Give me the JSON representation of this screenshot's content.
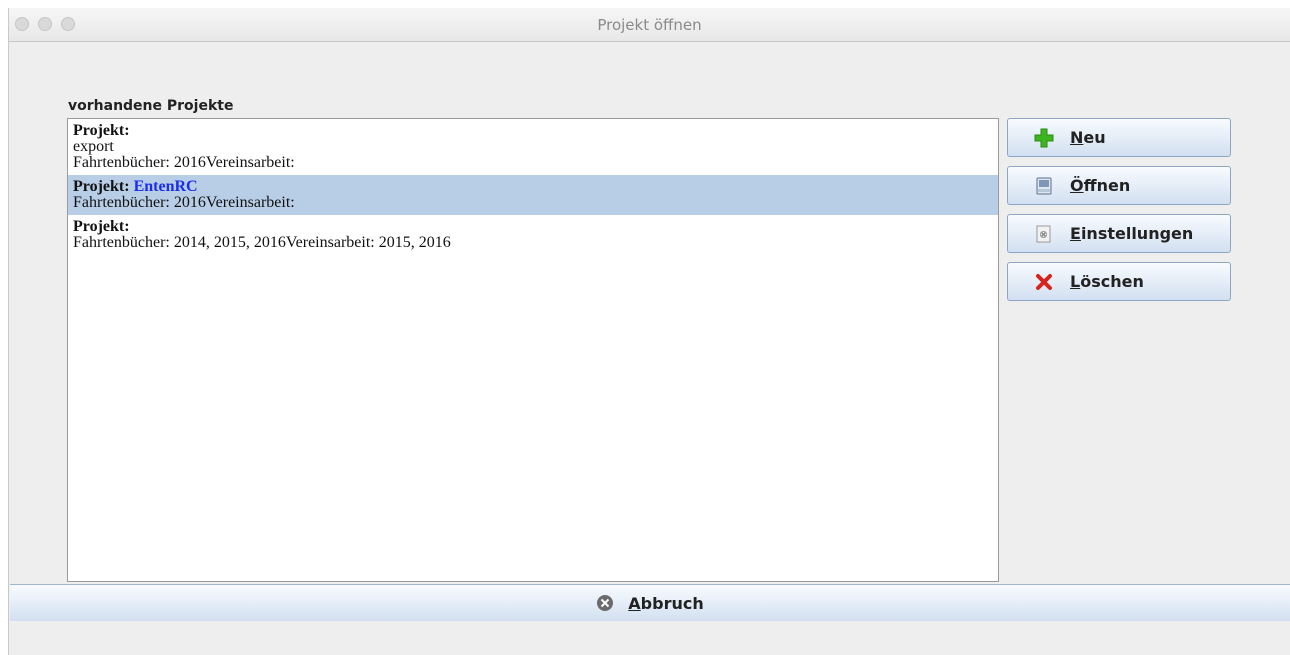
{
  "window": {
    "title": "Projekt öffnen"
  },
  "list": {
    "label": "vorhandene Projekte",
    "items": [
      {
        "label": "Projekt:",
        "name": "",
        "line2": "export",
        "line3": "Fahrtenbücher: 2016Vereinsarbeit:",
        "selected": false
      },
      {
        "label": "Projekt:",
        "name": "EntenRC",
        "line2": "Fahrtenbücher: 2016Vereinsarbeit:",
        "selected": true
      },
      {
        "label": "Projekt:",
        "name": "",
        "line2": "Fahrtenbücher: 2014, 2015, 2016Vereinsarbeit: 2015, 2016",
        "selected": false
      }
    ]
  },
  "buttons": {
    "new": {
      "mnemonic": "N",
      "rest": "eu",
      "icon": "plus-icon"
    },
    "open": {
      "mnemonic": "Ö",
      "rest": "ffnen",
      "icon": "folder-icon"
    },
    "settings": {
      "mnemonic": "E",
      "rest": "instellungen",
      "icon": "settings-icon"
    },
    "delete": {
      "mnemonic": "L",
      "rest": "öschen",
      "icon": "delete-x-icon"
    },
    "cancel": {
      "mnemonic": "A",
      "rest": "bbruch",
      "icon": "cancel-icon"
    }
  },
  "colors": {
    "selection": "#b8cde6",
    "project_name": "#1a2cf0",
    "plus": "#3cb521",
    "delete": "#d8231c"
  }
}
